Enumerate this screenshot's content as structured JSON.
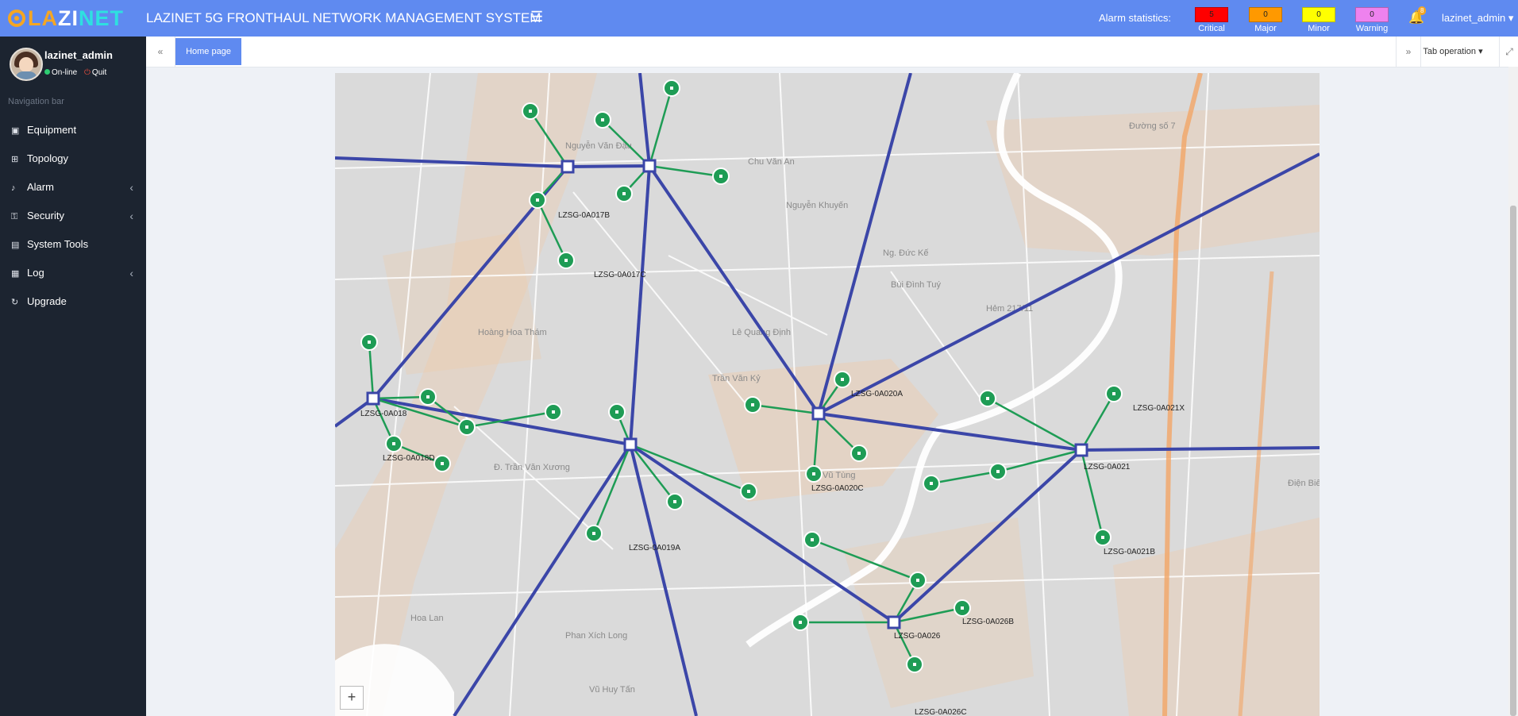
{
  "header": {
    "logo_parts": [
      "LA",
      "ZI",
      "NET"
    ],
    "title": "LAZINET 5G FRONTHAUL NETWORK MANAGEMENT SYSTEM",
    "menu_icon": "☰",
    "alarm_title": "Alarm statistics:",
    "alarms": [
      {
        "label": "Critical",
        "count": "5",
        "color": "#ff0000"
      },
      {
        "label": "Major",
        "count": "0",
        "color": "#ff9900"
      },
      {
        "label": "Minor",
        "count": "0",
        "color": "#ffff00"
      },
      {
        "label": "Warning",
        "count": "0",
        "color": "#ee82ee"
      }
    ],
    "bell_icon": "🔔",
    "bell_badge": "8",
    "user_menu": "lazinet_admin ▾"
  },
  "sidebar": {
    "username": "lazinet_admin",
    "status": "On-line",
    "quit": "Quit",
    "nav_heading": "Navigation bar",
    "items": [
      {
        "label": "Equipment",
        "icon": "▣",
        "has_children": false
      },
      {
        "label": "Topology",
        "icon": "⊞",
        "has_children": false
      },
      {
        "label": "Alarm",
        "icon": "♪",
        "has_children": true
      },
      {
        "label": "Security",
        "icon": "⚿",
        "has_children": true
      },
      {
        "label": "System Tools",
        "icon": "▤",
        "has_children": false
      },
      {
        "label": "Log",
        "icon": "▦",
        "has_children": true
      },
      {
        "label": "Upgrade",
        "icon": "↻",
        "has_children": false
      }
    ],
    "chevron": "‹"
  },
  "tabbar": {
    "back_icon": "«",
    "home_tab": "Home page",
    "forward_icon": "»",
    "operation": "Tab operation ▾",
    "fullscreen_icon": "⤢"
  },
  "map": {
    "zoom_in": "+",
    "labels": [
      "LZSG-0A017B",
      "LZSG-0A017C",
      "LZSG-0A018",
      "LZSG-0A018D",
      "LZSG-0A019A",
      "LZSG-0A020A",
      "LZSG-0A020C",
      "LZSG-0A021",
      "LZSG-0A021X",
      "LZSG-0A021B",
      "LZSG-0A026",
      "LZSG-0A026B",
      "LZSG-0A026C"
    ],
    "street_names": [
      "Chu Văn An",
      "Nguyễn Khuyến",
      "Lê Quang Định",
      "Bùi Đình Tuý",
      "Hoàng Hoa Thám",
      "Nguyễn Văn Đậu",
      "Ng. Đức Kế",
      "Trần Văn Kỷ",
      "Đ. Trần Văn Xương",
      "Phan Xích Long",
      "Hoa Lan",
      "Vũ Huy Tấn",
      "Điện Biên Phủ",
      "Đ. Vũ Tùng",
      "Hẻm 217/11",
      "Đường số 7"
    ]
  }
}
